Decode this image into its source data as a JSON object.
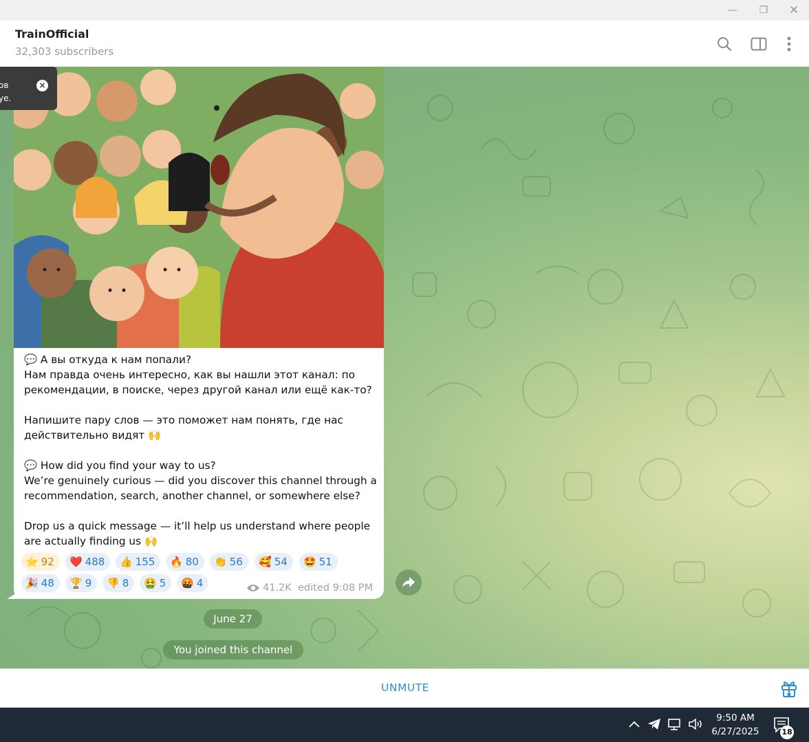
{
  "window": {
    "minimize_glyph": "—",
    "restore_glyph": "❐",
    "close_glyph": "✕"
  },
  "header": {
    "title": "TrainOfficial",
    "subtitle": "32,303 subscribers",
    "icons": [
      "search-icon",
      "sidebar-toggle-icon",
      "more-vertical-icon"
    ]
  },
  "tooltip": {
    "line1": "ов",
    "line2": "ye.",
    "close_glyph": "×"
  },
  "message": {
    "photo_description_icon": "illustration-image",
    "lines": [
      "💬 А вы откуда к нам попали?",
      "Нам правда очень интересно, как вы нашли этот канал: по",
      "рекомендации, в поиске, через другой канал или ещё как-то?",
      "",
      "Напишите пару слов — это поможет нам понять, где нас",
      "действительно видят 🙌",
      "",
      "💬 How did you find your way to us?",
      "We’re genuinely curious — did you discover this channel through a",
      "recommendation, search, another channel, or somewhere else?",
      "",
      "Drop us a quick message — it’ll help us understand where people",
      "are actually finding us 🙌"
    ],
    "reactions": [
      {
        "emoji": "⭐",
        "count": "92",
        "paid": true
      },
      {
        "emoji": "❤️",
        "count": "488"
      },
      {
        "emoji": "👍",
        "count": "155"
      },
      {
        "emoji": "🔥",
        "count": "80"
      },
      {
        "emoji": "👏",
        "count": "56"
      },
      {
        "emoji": "🥰",
        "count": "54"
      },
      {
        "emoji": "🤩",
        "count": "51"
      },
      {
        "emoji": "🎉",
        "count": "48"
      },
      {
        "emoji": "🏆",
        "count": "9"
      },
      {
        "emoji": "👎",
        "count": "8"
      },
      {
        "emoji": "🤮",
        "count": "5"
      },
      {
        "emoji": "🤬",
        "count": "4"
      }
    ],
    "views": "41.2K",
    "edited": "edited 9:08 PM"
  },
  "service": {
    "date": "June 27",
    "joined": "You joined this channel"
  },
  "bottom": {
    "unmute_label": "UNMUTE",
    "gift_icon": "gift-icon"
  },
  "taskbar": {
    "time": "9:50 AM",
    "date": "6/27/2025",
    "notification_count": "18",
    "icons": [
      "chevron-up-icon",
      "telegram-icon",
      "network-icon",
      "volume-icon",
      "notifications-icon"
    ]
  }
}
